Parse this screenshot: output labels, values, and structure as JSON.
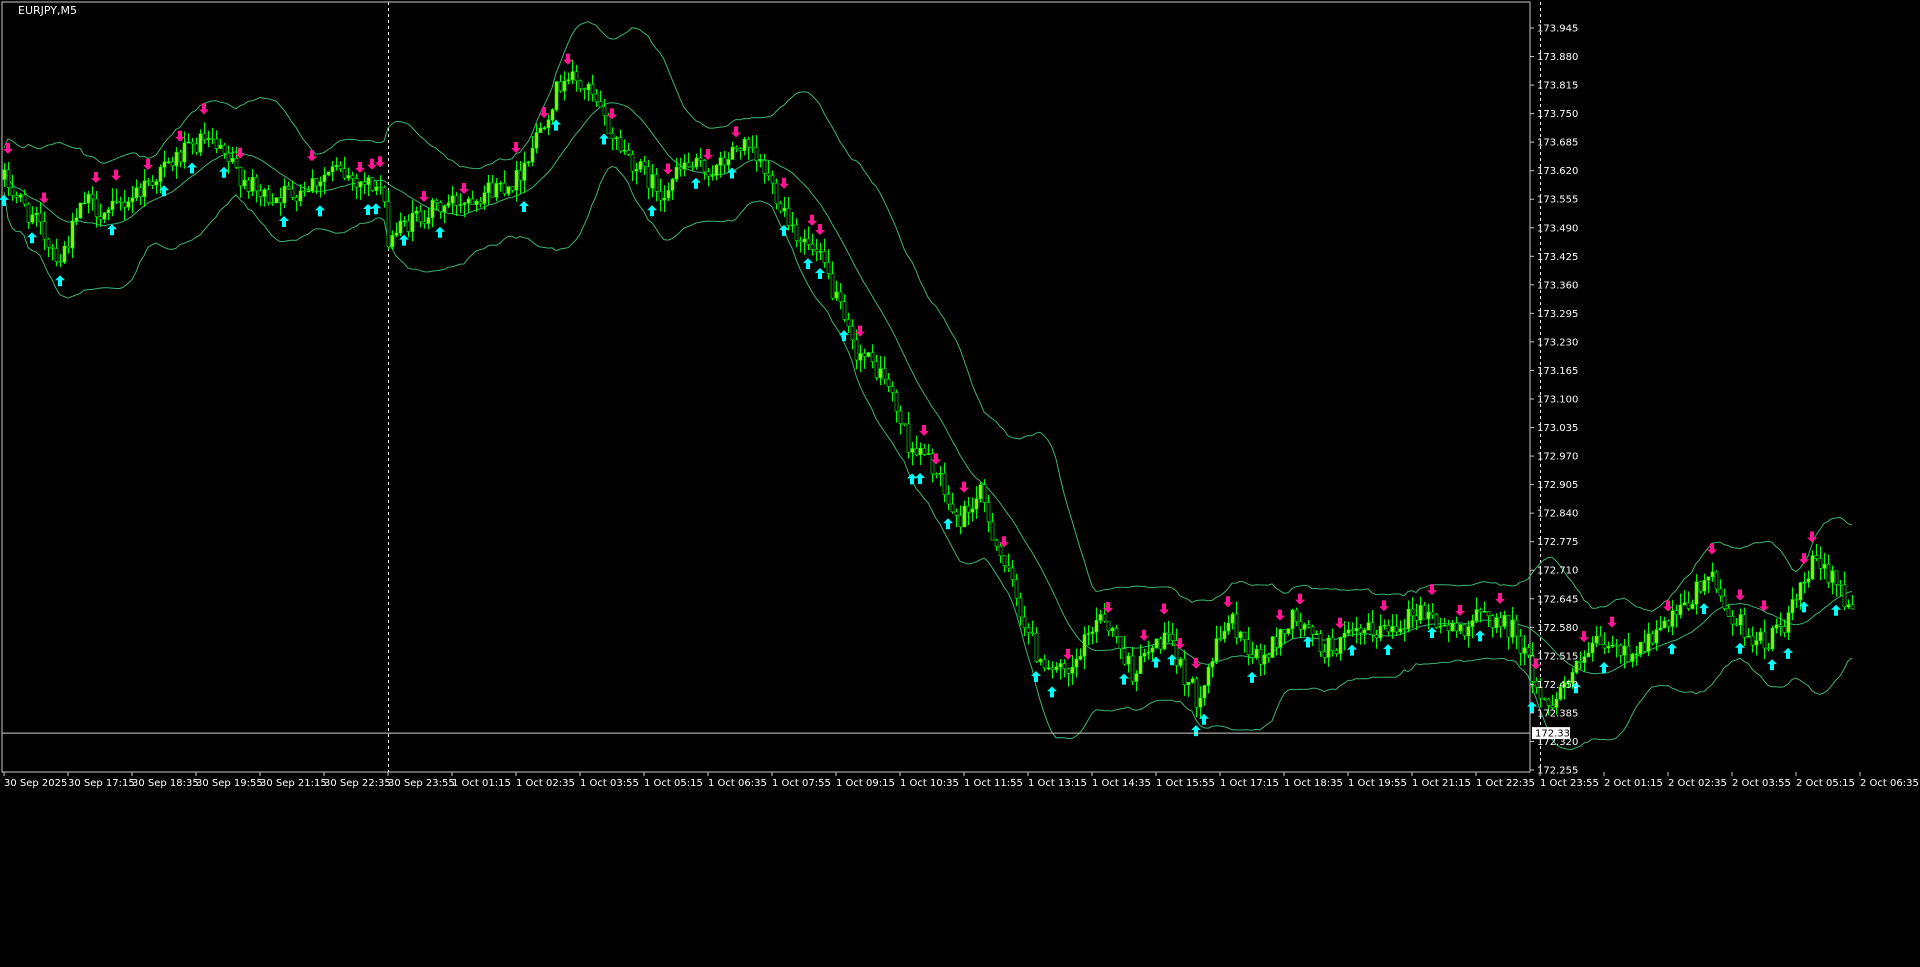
{
  "chart": {
    "symbol_label": "EURJPY,M5",
    "current_price_label": "172.339",
    "colors": {
      "background": "#000000",
      "frame": "#c8c8c8",
      "candle": "#00ff00",
      "candle_body_up": "#7cfc00",
      "band": "#3cb371",
      "arrow_up": "#00ffff",
      "arrow_down": "#ff1493",
      "separator": "#ffffff",
      "axis_text": "#ffffff",
      "price_line": "#d0d0d0"
    },
    "icons": {
      "arrow_up": "cyan-up-arrow-icon",
      "arrow_down": "magenta-down-arrow-icon"
    }
  },
  "chart_data": {
    "type": "candlestick",
    "title": "EURJPY,M5",
    "xlabel": "",
    "ylabel": "",
    "ylim": [
      172.255,
      173.945
    ],
    "y_ticks": [
      "173.945",
      "173.880",
      "173.815",
      "173.750",
      "173.685",
      "173.620",
      "173.555",
      "173.490",
      "173.425",
      "173.360",
      "173.295",
      "173.230",
      "173.165",
      "173.100",
      "173.035",
      "172.970",
      "172.905",
      "172.840",
      "172.775",
      "172.710",
      "172.645",
      "172.580",
      "172.515",
      "172.450",
      "172.385",
      "172.320",
      "172.255"
    ],
    "x_ticks": [
      "30 Sep 2025",
      "30 Sep 17:15",
      "30 Sep 18:35",
      "30 Sep 19:55",
      "30 Sep 21:15",
      "30 Sep 22:35",
      "30 Sep 23:55",
      "1 Oct 01:15",
      "1 Oct 02:35",
      "1 Oct 03:55",
      "1 Oct 05:15",
      "1 Oct 06:35",
      "1 Oct 07:55",
      "1 Oct 09:15",
      "1 Oct 10:35",
      "1 Oct 11:55",
      "1 Oct 13:15",
      "1 Oct 14:35",
      "1 Oct 15:55",
      "1 Oct 17:15",
      "1 Oct 18:35",
      "1 Oct 19:55",
      "1 Oct 21:15",
      "1 Oct 22:35",
      "1 Oct 23:55",
      "2 Oct 01:15",
      "2 Oct 02:35",
      "2 Oct 03:55",
      "2 Oct 05:15",
      "2 Oct 06:35"
    ],
    "day_separators": [
      "30 Sep 23:55",
      "1 Oct 23:55"
    ],
    "current_price": 172.339,
    "bars_per_tick": 16,
    "price_path": [
      {
        "bar": 0,
        "price": 173.6
      },
      {
        "bar": 8,
        "price": 173.5
      },
      {
        "bar": 14,
        "price": 173.42
      },
      {
        "bar": 20,
        "price": 173.55
      },
      {
        "bar": 26,
        "price": 173.52
      },
      {
        "bar": 34,
        "price": 173.58
      },
      {
        "bar": 42,
        "price": 173.64
      },
      {
        "bar": 50,
        "price": 173.69
      },
      {
        "bar": 56,
        "price": 173.64
      },
      {
        "bar": 64,
        "price": 173.56
      },
      {
        "bar": 72,
        "price": 173.57
      },
      {
        "bar": 82,
        "price": 173.62
      },
      {
        "bar": 94,
        "price": 173.58
      },
      {
        "bar": 96,
        "price": 173.47
      },
      {
        "bar": 104,
        "price": 173.52
      },
      {
        "bar": 116,
        "price": 173.56
      },
      {
        "bar": 128,
        "price": 173.6
      },
      {
        "bar": 134,
        "price": 173.72
      },
      {
        "bar": 140,
        "price": 173.84
      },
      {
        "bar": 146,
        "price": 173.8
      },
      {
        "bar": 152,
        "price": 173.7
      },
      {
        "bar": 158,
        "price": 173.63
      },
      {
        "bar": 164,
        "price": 173.57
      },
      {
        "bar": 170,
        "price": 173.63
      },
      {
        "bar": 178,
        "price": 173.62
      },
      {
        "bar": 184,
        "price": 173.68
      },
      {
        "bar": 190,
        "price": 173.62
      },
      {
        "bar": 198,
        "price": 173.48
      },
      {
        "bar": 205,
        "price": 173.4
      },
      {
        "bar": 212,
        "price": 173.22
      },
      {
        "bar": 220,
        "price": 173.15
      },
      {
        "bar": 226,
        "price": 173.0
      },
      {
        "bar": 232,
        "price": 172.95
      },
      {
        "bar": 238,
        "price": 172.82
      },
      {
        "bar": 244,
        "price": 172.88
      },
      {
        "bar": 250,
        "price": 172.72
      },
      {
        "bar": 258,
        "price": 172.52
      },
      {
        "bar": 266,
        "price": 172.46
      },
      {
        "bar": 274,
        "price": 172.62
      },
      {
        "bar": 282,
        "price": 172.48
      },
      {
        "bar": 290,
        "price": 172.56
      },
      {
        "bar": 298,
        "price": 172.42
      },
      {
        "bar": 306,
        "price": 172.6
      },
      {
        "bar": 314,
        "price": 172.5
      },
      {
        "bar": 322,
        "price": 172.6
      },
      {
        "bar": 330,
        "price": 172.53
      },
      {
        "bar": 338,
        "price": 172.56
      },
      {
        "bar": 346,
        "price": 172.58
      },
      {
        "bar": 354,
        "price": 172.62
      },
      {
        "bar": 362,
        "price": 172.57
      },
      {
        "bar": 370,
        "price": 172.61
      },
      {
        "bar": 378,
        "price": 172.57
      },
      {
        "bar": 385,
        "price": 172.4
      },
      {
        "bar": 392,
        "price": 172.47
      },
      {
        "bar": 398,
        "price": 172.54
      },
      {
        "bar": 406,
        "price": 172.52
      },
      {
        "bar": 414,
        "price": 172.57
      },
      {
        "bar": 420,
        "price": 172.62
      },
      {
        "bar": 426,
        "price": 172.7
      },
      {
        "bar": 432,
        "price": 172.6
      },
      {
        "bar": 440,
        "price": 172.54
      },
      {
        "bar": 446,
        "price": 172.6
      },
      {
        "bar": 452,
        "price": 172.72
      },
      {
        "bar": 458,
        "price": 172.7
      },
      {
        "bar": 462,
        "price": 172.6
      }
    ],
    "signals_up_bars": [
      0,
      7,
      14,
      27,
      40,
      47,
      55,
      70,
      79,
      91,
      93,
      100,
      109,
      130,
      138,
      150,
      162,
      173,
      182,
      195,
      201,
      204,
      210,
      227,
      229,
      236,
      258,
      262,
      280,
      288,
      292,
      298,
      300,
      312,
      326,
      337,
      346,
      357,
      369,
      382,
      393,
      400,
      417,
      425,
      434,
      442,
      446,
      450,
      458
    ],
    "signals_down_bars": [
      1,
      10,
      23,
      28,
      36,
      44,
      50,
      59,
      77,
      89,
      92,
      94,
      105,
      115,
      128,
      135,
      141,
      152,
      166,
      176,
      183,
      195,
      202,
      204,
      214,
      230,
      233,
      240,
      250,
      266,
      276,
      285,
      290,
      294,
      298,
      306,
      319,
      324,
      334,
      345,
      357,
      364,
      374,
      383,
      395,
      402,
      416,
      427,
      434,
      440,
      450,
      452
    ],
    "bollinger_band_series": [
      {
        "name": "",
        "values": "upper"
      },
      {
        "name": "",
        "values": "middle"
      },
      {
        "name": "",
        "values": "lower"
      }
    ]
  }
}
